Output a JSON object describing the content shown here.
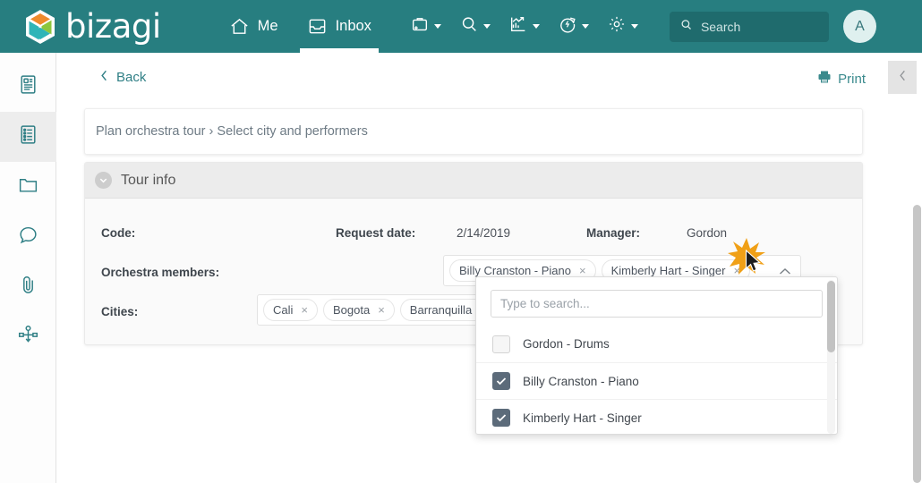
{
  "header": {
    "brand": "bizagi",
    "brand_icon": "bizagi-hexagon-logo",
    "nav": [
      {
        "label": "Me",
        "icon": "home-icon",
        "active": false
      },
      {
        "label": "Inbox",
        "icon": "inbox-icon",
        "active": true
      }
    ],
    "icon_buttons": [
      {
        "name": "new-case-icon",
        "has_caret": true
      },
      {
        "name": "search-icon",
        "has_caret": true
      },
      {
        "name": "analytics-chart-icon",
        "has_caret": true
      },
      {
        "name": "refresh-circle-icon",
        "has_caret": true
      },
      {
        "name": "gear-icon",
        "has_caret": true
      }
    ],
    "search": {
      "placeholder": "Search",
      "value": "",
      "icon": "search-icon"
    },
    "avatar": {
      "initial": "A"
    },
    "colors": {
      "bar": "#277e80",
      "search_field": "#1f6b6d",
      "avatar_bg": "#dff0ef"
    }
  },
  "sidebar": {
    "items": [
      {
        "name": "case-summary-icon",
        "active": false
      },
      {
        "name": "form-list-icon",
        "active": true
      },
      {
        "name": "folder-icon",
        "active": false
      },
      {
        "name": "comments-icon",
        "active": false
      },
      {
        "name": "attachment-clip-icon",
        "active": false
      },
      {
        "name": "process-diagram-icon",
        "active": false
      }
    ]
  },
  "toolbar": {
    "back_label": "Back",
    "back_icon": "chevron-left-icon",
    "print_label": "Print",
    "print_icon": "printer-icon",
    "collapse_icon": "chevron-left-icon"
  },
  "breadcrumb": {
    "text": "Plan orchestra tour › Select city and performers",
    "parent": "Plan orchestra tour",
    "current": "Select city and performers"
  },
  "form": {
    "section": {
      "title": "Tour info",
      "collapse_icon": "chevron-down-circle-icon"
    },
    "fields": {
      "code_label": "Code:",
      "code_value": "",
      "request_date_label": "Request date:",
      "request_date_value": "2/14/2019",
      "manager_label": "Manager:",
      "manager_value": "Gordon",
      "orchestra_members_label": "Orchestra members:",
      "cities_label": "Cities:"
    },
    "orchestra_members_chips": [
      {
        "label": "Billy Cranston - Piano",
        "remove": "×"
      },
      {
        "label": "Kimberly Hart - Singer",
        "remove": "×"
      }
    ],
    "orchestra_members_arrow": "chevron-up-icon",
    "cities_chips": [
      {
        "label": "Cali",
        "remove": "×"
      },
      {
        "label": "Bogota",
        "remove": "×"
      },
      {
        "label": "Barranquilla",
        "remove": "×"
      }
    ],
    "cities_placeholder": "Type to search..."
  },
  "dropdown": {
    "search_placeholder": "Type to search...",
    "search_value": "",
    "options": [
      {
        "label": "Gordon - Drums",
        "checked": false
      },
      {
        "label": "Billy Cranston - Piano",
        "checked": true
      },
      {
        "label": "Kimberly Hart - Singer",
        "checked": true
      }
    ],
    "checked_color": "#5c6b7a"
  },
  "pointer": {
    "click_burst_color": "#f0a017",
    "cursor_icon": "mouse-arrow-cursor"
  }
}
